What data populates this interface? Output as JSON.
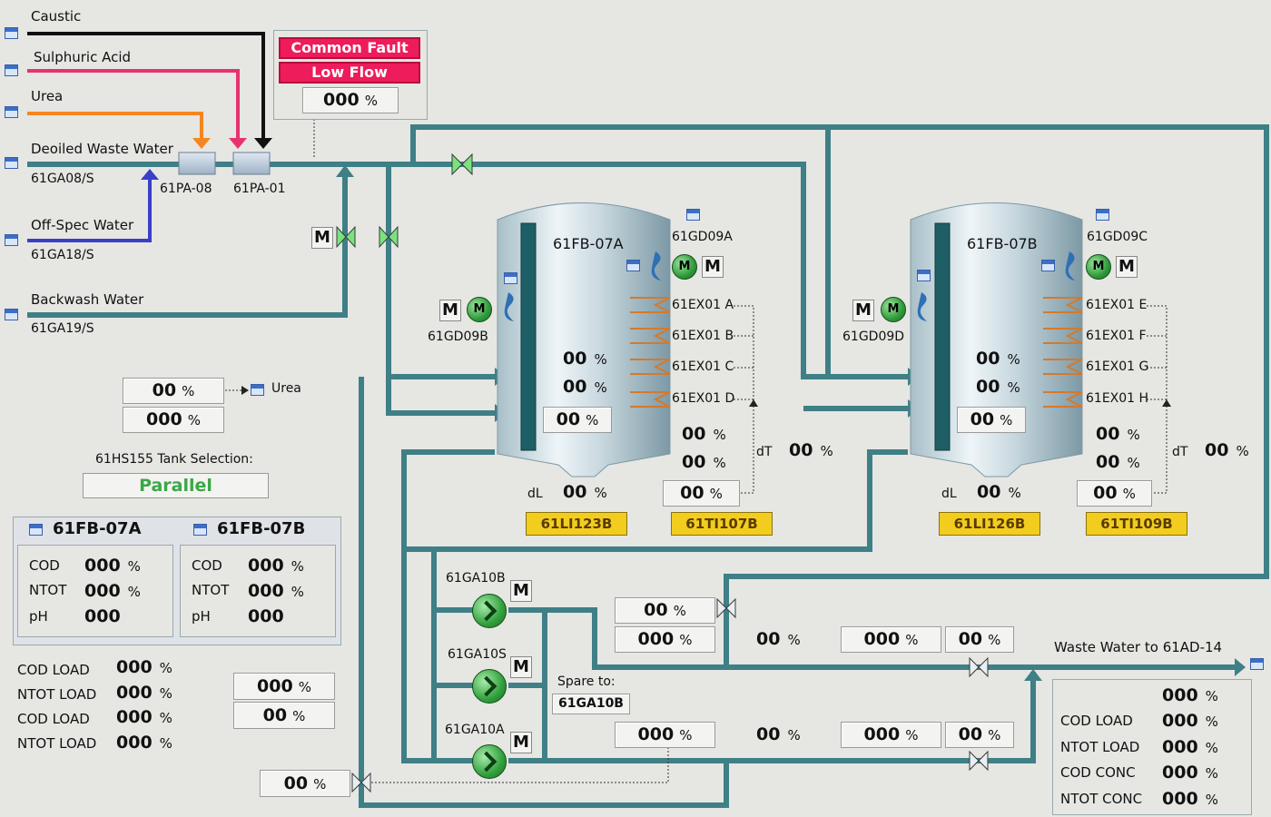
{
  "sources": {
    "caustic": "Caustic",
    "sulphuric_acid": "Sulphuric Acid",
    "urea": "Urea",
    "deoiled_waste_water": "Deoiled Waste Water",
    "deoiled_tag": "61GA08/S",
    "offspec_water": "Off-Spec Water",
    "offspec_tag": "61GA18/S",
    "backwash_water": "Backwash Water",
    "backwash_tag": "61GA19/S"
  },
  "mixers": {
    "pa08": "61PA-08",
    "pa01": "61PA-01"
  },
  "alarms": {
    "common_fault": "Common Fault",
    "low_flow": "Low Flow",
    "value": "000",
    "unit": "%"
  },
  "urea_dosing": {
    "val1": "00",
    "val2": "000",
    "unit": "%",
    "target": "Urea"
  },
  "tank_selection": {
    "label": "61HS155 Tank Selection:",
    "value": "Parallel"
  },
  "quality_panel": {
    "tank_a": "61FB-07A",
    "tank_b": "61FB-07B",
    "rows": [
      {
        "label": "COD",
        "a": "000",
        "b": "000",
        "unit": "%"
      },
      {
        "label": "NTOT",
        "a": "000",
        "b": "000",
        "unit": "%"
      },
      {
        "label": "pH",
        "a": "000",
        "b": "000",
        "unit": ""
      }
    ]
  },
  "loads": [
    {
      "label": "COD LOAD",
      "value": "000",
      "unit": "%"
    },
    {
      "label": "NTOT LOAD",
      "value": "000",
      "unit": "%"
    },
    {
      "label": "COD LOAD",
      "value": "000",
      "unit": "%"
    },
    {
      "label": "NTOT LOAD",
      "value": "000",
      "unit": "%"
    }
  ],
  "mid_boxes": {
    "b1": "000",
    "b2": "00",
    "bottom": "00",
    "unit": "%"
  },
  "tank_a": {
    "name": "61FB-07A",
    "gd_left": "61GD09B",
    "gd_right": "61GD09A",
    "ex": [
      "61EX01 A",
      "61EX01 B",
      "61EX01 C",
      "61EX01 D"
    ],
    "levels": [
      "00",
      "00",
      "00"
    ],
    "temps": [
      "00",
      "00",
      "00"
    ],
    "dl_label": "dL",
    "dl": "00",
    "dt_label": "dT",
    "dt": "00",
    "level_tag": "61LI123B",
    "temp_tag": "61TI107B",
    "unit": "%"
  },
  "tank_b": {
    "name": "61FB-07B",
    "gd_left": "61GD09D",
    "gd_right": "61GD09C",
    "ex": [
      "61EX01 E",
      "61EX01 F",
      "61EX01 G",
      "61EX01 H"
    ],
    "levels": [
      "00",
      "00",
      "00"
    ],
    "temps": [
      "00",
      "00",
      "00"
    ],
    "dl_label": "dL",
    "dl": "00",
    "dt_label": "dT",
    "dt": "00",
    "level_tag": "61LI126B",
    "temp_tag": "61TI109B",
    "unit": "%"
  },
  "pumps": {
    "p10b": "61GA10B",
    "p10s": "61GA10S",
    "p10a": "61GA10A",
    "spare_label": "Spare to:",
    "spare_value": "61GA10B"
  },
  "flow_upper": {
    "a": "00",
    "b": "000",
    "c": "00",
    "d": "000",
    "e": "00",
    "unit": "%"
  },
  "flow_lower": {
    "a": "000",
    "b": "00",
    "c": "000",
    "d": "00",
    "unit": "%"
  },
  "waste_water": {
    "label": "Waste Water to 61AD-14"
  },
  "output_panel": {
    "top": "000",
    "rows": [
      {
        "label": "COD LOAD",
        "value": "000"
      },
      {
        "label": "NTOT LOAD",
        "value": "000"
      },
      {
        "label": "COD CONC",
        "value": "000"
      },
      {
        "label": "NTOT CONC",
        "value": "000"
      }
    ],
    "unit": "%"
  },
  "motor_label": "M",
  "colors": {
    "pipe": "#3f7f86",
    "pipe_dark": "#2a5f66",
    "caustic": "#111111",
    "acid": "#e8326f",
    "urea": "#f5861f",
    "offspec": "#3b3fc8",
    "alarm": "#ee1c5a",
    "tag": "#f2cd1e"
  }
}
